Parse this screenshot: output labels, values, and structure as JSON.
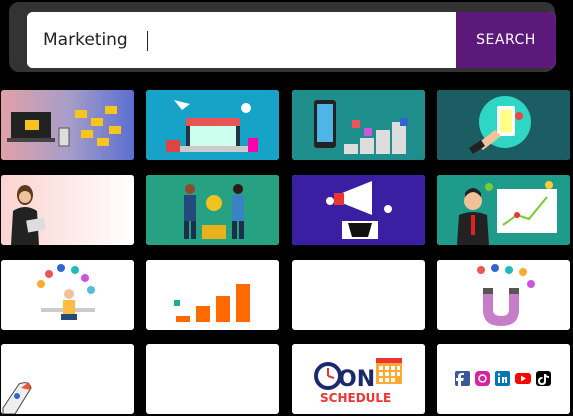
{
  "search": {
    "value": "Marketing",
    "button_label": "SEARCH"
  },
  "results": {
    "badges": {
      "on": "ON",
      "schedule": "SCHEDULE"
    },
    "icons": [
      "email-marketing-laptop",
      "online-store",
      "social-phone",
      "hand-phone",
      "businesswoman",
      "money-exchange",
      "megaphone",
      "presentation-chart",
      "social-network-person",
      "bar-chart-growth",
      "blank",
      "magnet-social",
      "rocket",
      "blank",
      "calendar-schedule",
      "social-media-logos"
    ]
  }
}
